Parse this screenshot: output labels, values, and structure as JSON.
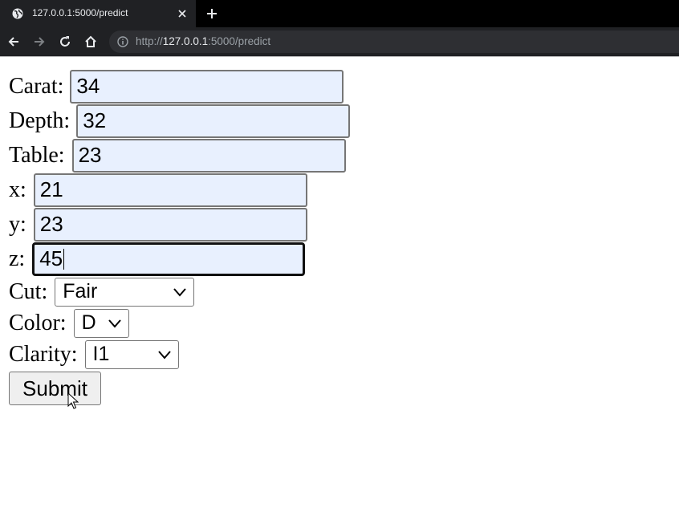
{
  "browser": {
    "tab_title": "127.0.0.1:5000/predict",
    "url_host": "127.0.0.1",
    "url_rest": ":5000/predict",
    "url_scheme": "http://"
  },
  "form": {
    "carat": {
      "label": "Carat:",
      "value": "34"
    },
    "depth": {
      "label": "Depth:",
      "value": "32"
    },
    "table": {
      "label": "Table:",
      "value": "23"
    },
    "x": {
      "label": "x:",
      "value": "21"
    },
    "y": {
      "label": "y:",
      "value": "23"
    },
    "z": {
      "label": "z:",
      "value": "45"
    },
    "cut": {
      "label": "Cut:",
      "selected": "Fair"
    },
    "color": {
      "label": "Color:",
      "selected": "D"
    },
    "clarity": {
      "label": "Clarity:",
      "selected": "I1"
    },
    "submit_label": "Submit"
  },
  "colors": {
    "chrome_bg": "#202124",
    "input_autofill_bg": "#e8f0fe"
  }
}
